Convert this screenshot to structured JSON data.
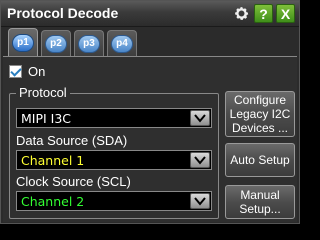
{
  "window": {
    "title": "Protocol Decode"
  },
  "titlebar": {
    "help_label": "?",
    "close_label": "X",
    "gear_icon": "gear-icon"
  },
  "tabs": [
    {
      "label": "p1",
      "active": true
    },
    {
      "label": "p2",
      "active": false
    },
    {
      "label": "p3",
      "active": false
    },
    {
      "label": "p4",
      "active": false
    }
  ],
  "on_checkbox": {
    "label": "On",
    "checked": true
  },
  "protocol_group": {
    "legend": "Protocol",
    "protocol_value": "MIPI I3C",
    "data_source_label": "Data Source (SDA)",
    "data_source_value": "Channel 1",
    "clock_source_label": "Clock Source (SCL)",
    "clock_source_value": "Channel 2"
  },
  "buttons": {
    "configure_legacy": "Configure Legacy I2C Devices ...",
    "auto_setup": "Auto Setup",
    "manual_setup": "Manual Setup..."
  },
  "colors": {
    "channel1": "#ffff33",
    "channel2": "#33ff33",
    "tab_accent": "#4a86c8"
  }
}
